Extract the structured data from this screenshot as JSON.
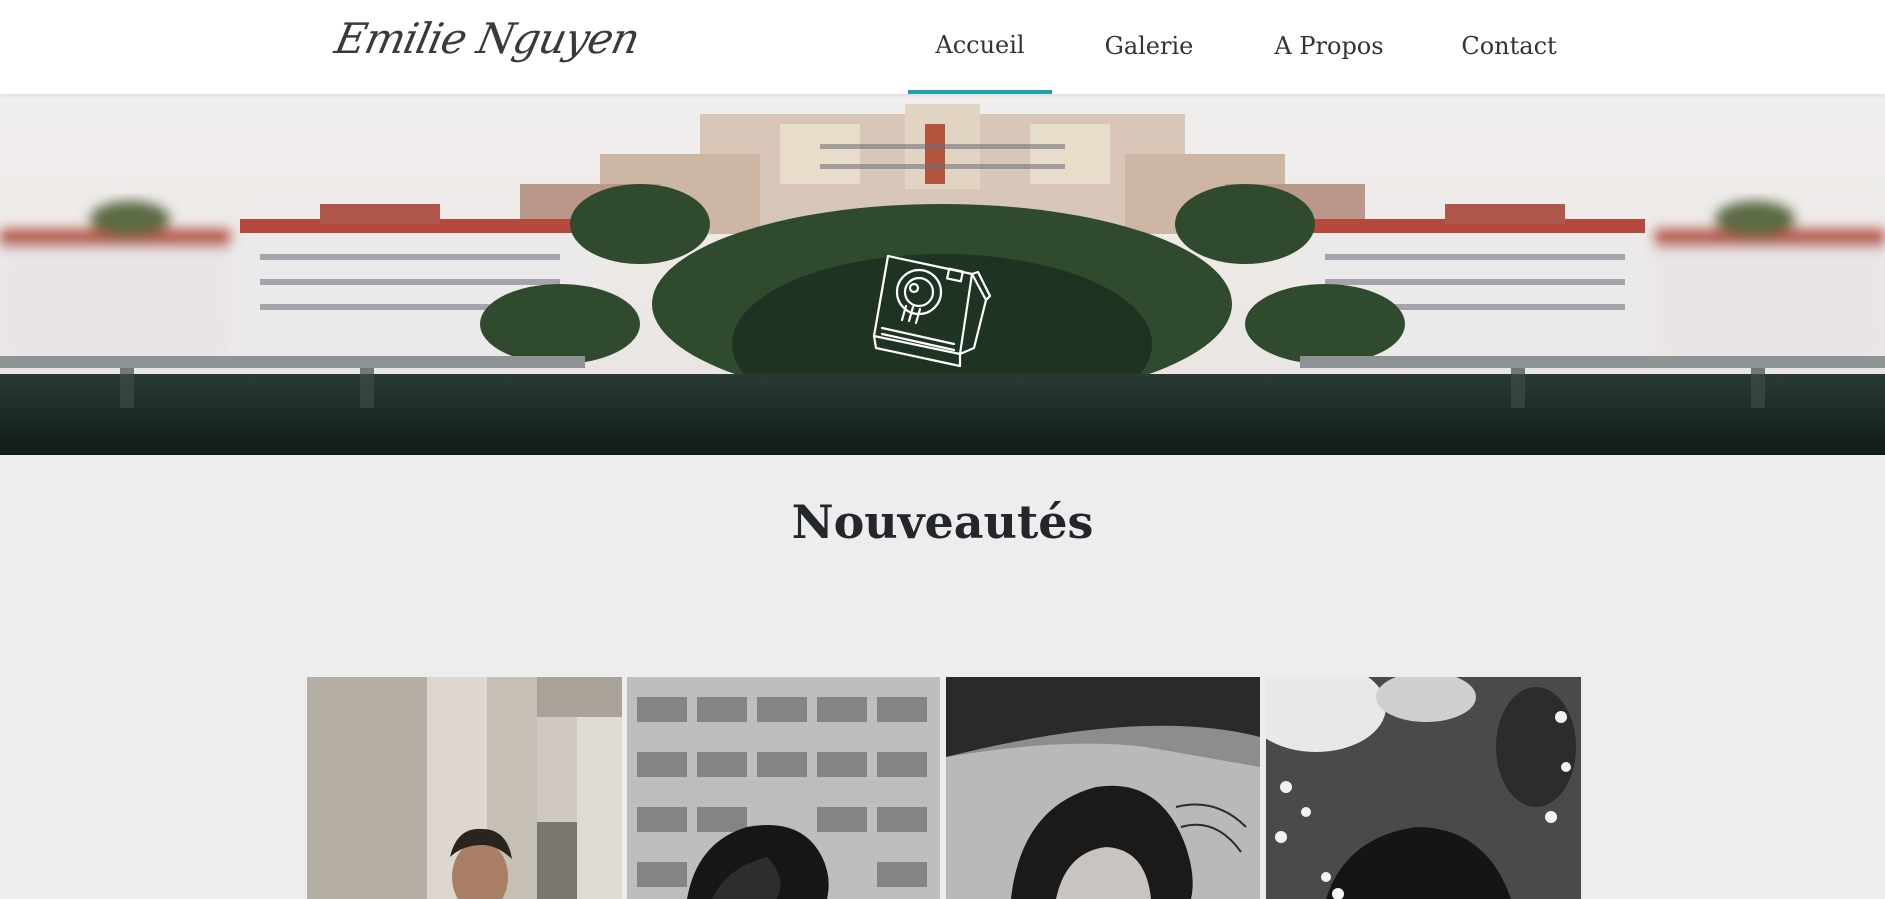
{
  "site": {
    "logo_text": "Emilie Nguyen"
  },
  "nav": {
    "items": [
      {
        "label": "Accueil",
        "active": true
      },
      {
        "label": "Galerie",
        "active": false
      },
      {
        "label": "A Propos",
        "active": false
      },
      {
        "label": "Contact",
        "active": false
      }
    ]
  },
  "hero": {
    "icon": "camera-icon"
  },
  "news": {
    "title": "Nouveautés",
    "photos": [
      "photo-man-building",
      "photo-woman-hair-building",
      "photo-woman-wind",
      "photo-woman-flowers"
    ]
  },
  "colors": {
    "accent": "#1fa2ad",
    "background": "#ededed",
    "header": "#ffffff"
  }
}
